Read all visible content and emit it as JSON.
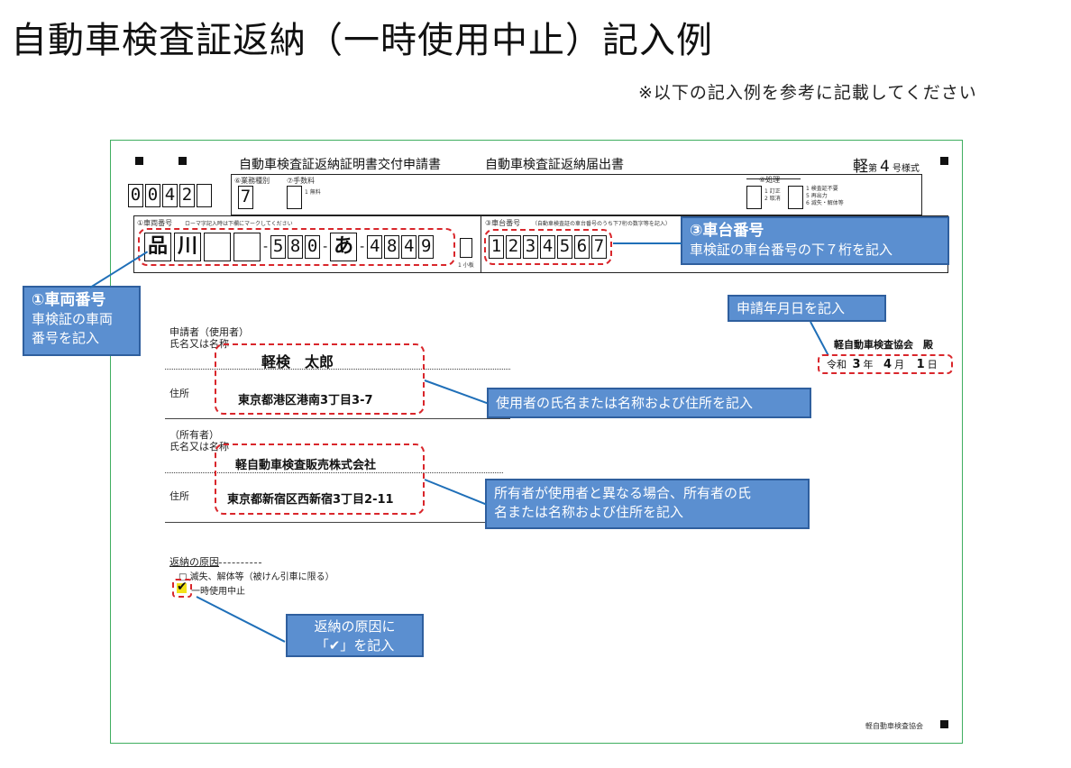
{
  "title": "自動車検査証返納（一時使用中止）記入例",
  "note": "※以下の記入例を参考に記載してください",
  "form": {
    "title_left": "自動車検査証返納証明書交付申請書",
    "title_right": "自動車検査証返納届出書",
    "form_no_kei": "軽",
    "form_no_dai": "第",
    "form_no_num": "4",
    "form_no_suffix": "号様式",
    "form_code_digits": [
      "0",
      "0",
      "4",
      "2",
      ""
    ],
    "gyomu_label": "⑥業務種別",
    "gyomu_value": "7",
    "tesuryo_label": "⑦手数料",
    "tesuryo_option": "1 無料",
    "shori_label": "⑥処理",
    "shori_a": "1 訂正",
    "shori_b": "2 取消",
    "shori_c1": "1 検査証不要",
    "shori_c2": "5 再出力",
    "shori_c3": "6 滅失・解体等",
    "vehicle_no_label": "①車両番号",
    "vehicle_no_hint": "ローマ字記入時は下欄にマークしてください",
    "vehicle_chars": [
      "品",
      "川",
      "",
      ""
    ],
    "vehicle_class": [
      "5",
      "8",
      "0"
    ],
    "vehicle_kana": "あ",
    "vehicle_serial": [
      "4",
      "8",
      "4",
      "9"
    ],
    "small_plate": "1 小板",
    "chassis_label": "③車台番号",
    "chassis_hint": "（自動車検査証の車台番号のうち下7桁の数字等を記入）",
    "chassis_digits": [
      "1",
      "2",
      "3",
      "4",
      "5",
      "6",
      "7"
    ],
    "applicant_label_1": "申請者（使用者）",
    "applicant_label_2": "氏名又は名称",
    "applicant_name": "軽検　太郎",
    "address_label": "住所",
    "applicant_address": "東京都港区港南3丁目3-7",
    "owner_label_1": "（所有者）",
    "owner_label_2": "氏名又は名称",
    "owner_name": "軽自動車検査販売株式会社",
    "owner_address_label": "住所",
    "owner_address": "東京都新宿区西新宿3丁目2-11",
    "addressee": "軽自動車検査協会　殿",
    "date_era": "令和",
    "date_year": "3",
    "date_year_unit": "年",
    "date_month": "4",
    "date_month_unit": "月",
    "date_day": "1",
    "date_day_unit": "日",
    "reason_title": "返納の原因",
    "reason_1": "□ 滅失、解体等（被けん引車に限る）",
    "reason_2": "一時使用中止",
    "check_mark": "✔",
    "footer_org": "軽自動車検査協会"
  },
  "callouts": {
    "vehicle_title": "①車両番号",
    "vehicle_body_1": "車検証の車両",
    "vehicle_body_2": "番号を記入",
    "chassis_title": "③車台番号",
    "chassis_body": "車検証の車台番号の下７桁を記入",
    "date": "申請年月日を記入",
    "applicant": "使用者の氏名または名称および住所を記入",
    "owner_1": "所有者が使用者と異なる場合、所有者の氏",
    "owner_2": "名または名称および住所を記入",
    "reason_1": "返納の原因に",
    "reason_2": "「✔」を記入"
  },
  "colors": {
    "callout_fill": "#5b8fd0",
    "callout_border": "#2f5f9e",
    "dashed_highlight": "#d9262b",
    "sheet_border": "#3fae5f",
    "leader_line": "#1f6fb8"
  }
}
